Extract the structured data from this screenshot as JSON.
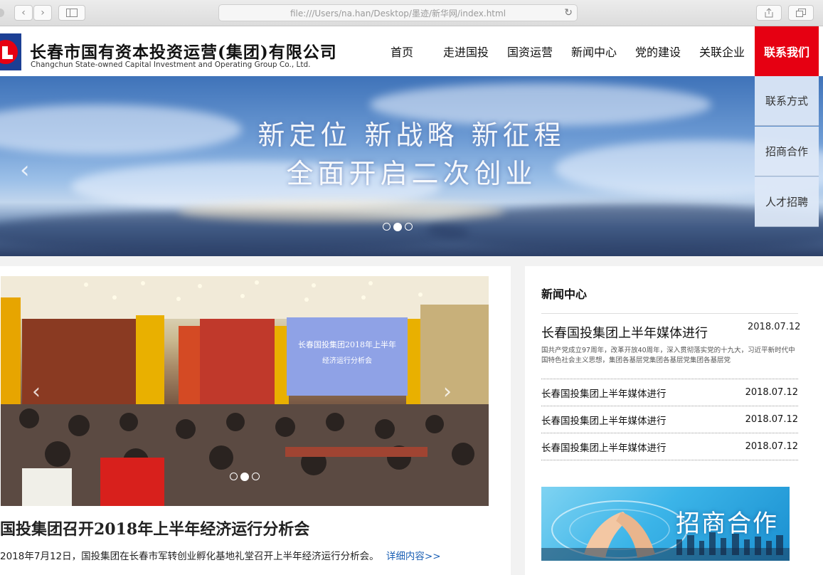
{
  "browser": {
    "url": "file:///Users/na.han/Desktop/墨迹/新华网/index.html"
  },
  "header": {
    "cn_name": "长春市国有资本投资运营(集团)有限公司",
    "en_name": "Changchun State-owned Capital Investment and Operating Group Co., Ltd.",
    "nav": [
      "首页",
      "走进国投",
      "国资运营",
      "新闻中心",
      "党的建设",
      "关联企业",
      "联系我们"
    ]
  },
  "dropdown": [
    "联系方式",
    "招商合作",
    "人才招聘"
  ],
  "banner": {
    "slogan_line1": "新定位 新战略 新征程",
    "slogan_line2": "全面开启二次创业",
    "active_slide": 2,
    "slide_count": 3
  },
  "feature": {
    "photo_screen_text_1": "长春国投集团2018年上半年",
    "photo_screen_text_2": "经济运行分析会",
    "title": "国投集团召开2018年上半年经济运行分析会",
    "summary": "2018年7月12日，国投集团在长春市军转创业孵化基地礼堂召开上半年经济运行分析会。",
    "more": "详细内容>>",
    "active_slide": 2,
    "slide_count": 3
  },
  "news": {
    "heading": "新闻中心",
    "featured": {
      "title": "长春国投集团上半年媒体进行",
      "date": "2018.07.12",
      "desc": "国共产党成立97周年，改革开放40周年，深入贯彻落实党的十九大，习近平新时代中国特色社会主义思想，集团各基层党集团各基层党集团各基层党"
    },
    "items": [
      {
        "title": "长春国投集团上半年媒体进行",
        "date": "2018.07.12"
      },
      {
        "title": "长春国投集团上半年媒体进行",
        "date": "2018.07.12"
      },
      {
        "title": "长春国投集团上半年媒体进行",
        "date": "2018.07.12"
      }
    ]
  },
  "ad": {
    "text": "招商合作"
  },
  "colors": {
    "accent_red": "#e60012",
    "link_blue": "#1a5fb4",
    "dropdown_bg": "#dde8f6"
  }
}
